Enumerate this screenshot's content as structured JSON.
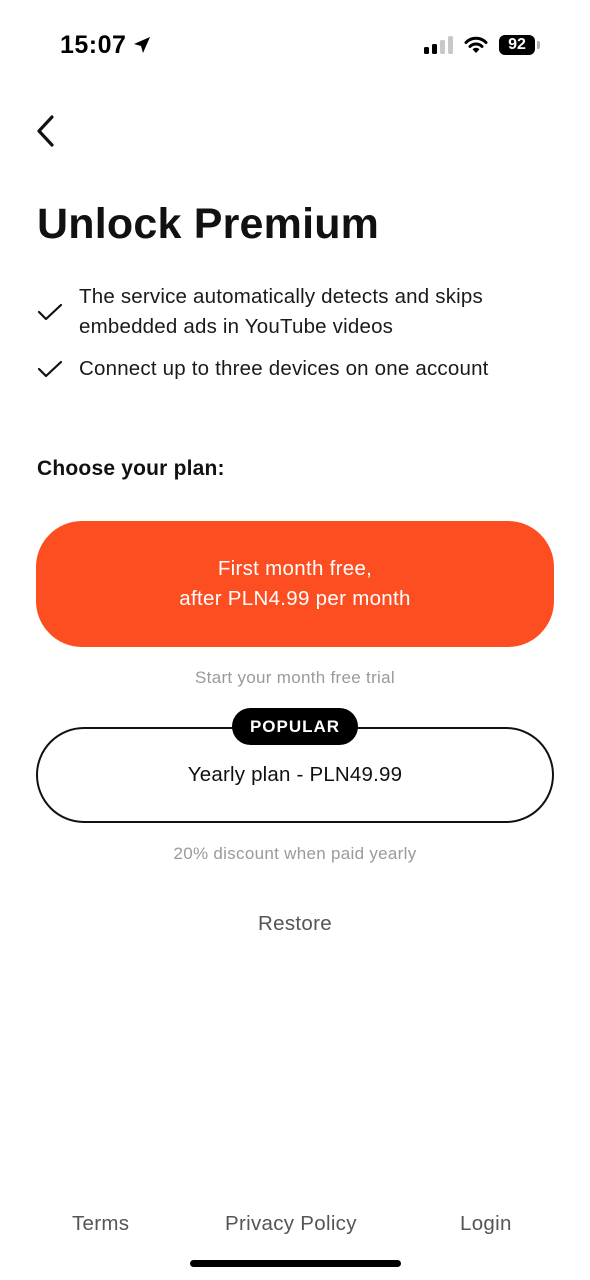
{
  "status_bar": {
    "time": "15:07",
    "battery": "92",
    "icons": [
      "location-arrow-icon",
      "cellular-signal-icon",
      "wifi-icon",
      "battery-icon"
    ]
  },
  "nav": {
    "back_icon": "chevron-left-icon"
  },
  "title": "Unlock Premium",
  "features": [
    {
      "icon": "checkmark-icon",
      "line1": "The service automatically detects and skips",
      "line2": "embedded ads in YouTube videos"
    },
    {
      "icon": "checkmark-icon",
      "line1": "Connect up to three devices on one account",
      "line2": ""
    }
  ],
  "plans": {
    "label": "Choose your plan:",
    "trial": {
      "line1": "First month free,",
      "line2": "after PLN4.99 per month",
      "caption": "Start your month free trial",
      "color": "#fd4e22"
    },
    "yearly": {
      "badge": "POPULAR",
      "label": "Yearly plan - PLN49.99",
      "caption": "20% discount when paid yearly"
    }
  },
  "restore_label": "Restore",
  "footer": {
    "terms": "Terms",
    "privacy": "Privacy Policy",
    "login": "Login"
  }
}
